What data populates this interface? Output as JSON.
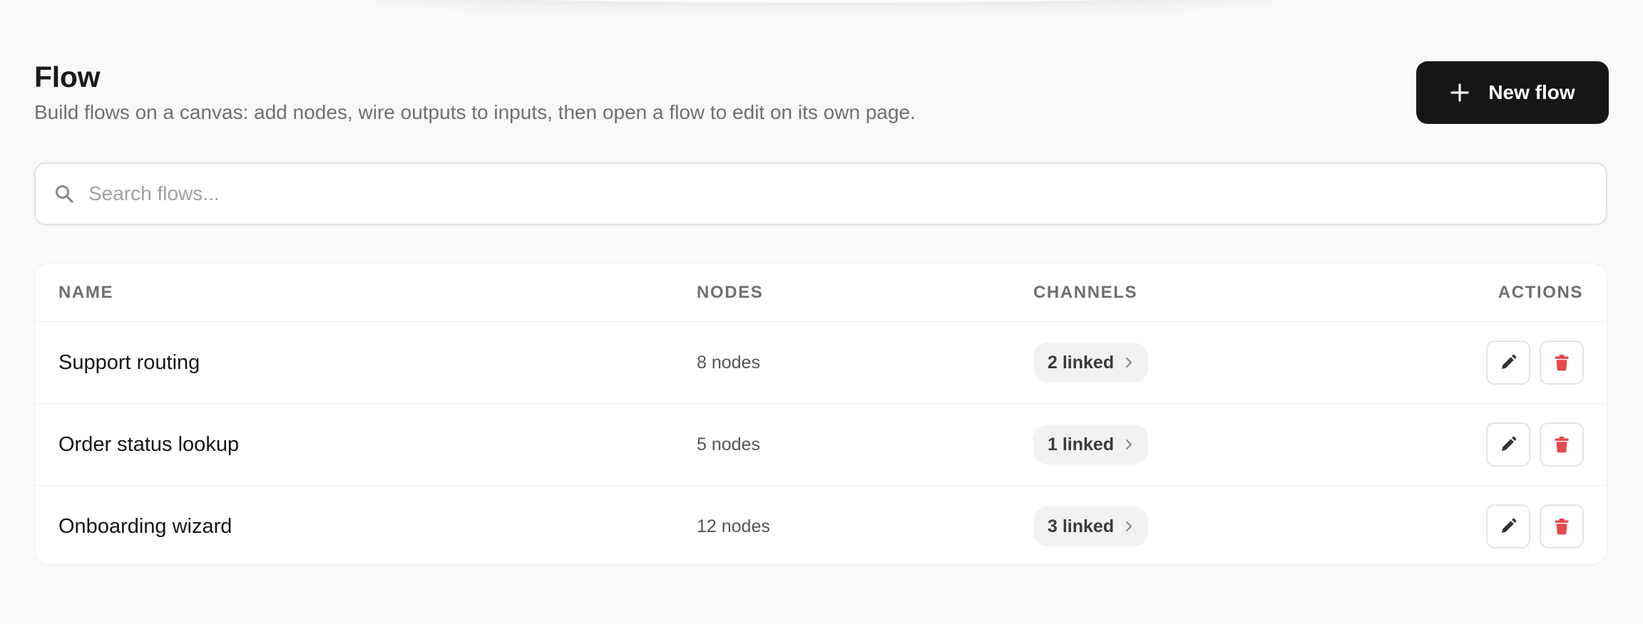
{
  "header": {
    "title": "Flow",
    "subtitle": "Build flows on a canvas: add nodes, wire outputs to inputs, then open a flow to edit on its own page.",
    "new_button_label": "New flow",
    "new_button_icon": "plus-icon"
  },
  "search": {
    "placeholder": "Search flows...",
    "value": "",
    "icon": "search-icon"
  },
  "table": {
    "columns": {
      "name": "NAME",
      "nodes": "NODES",
      "channels": "CHANNELS",
      "actions": "ACTIONS"
    },
    "rows": [
      {
        "name": "Support routing",
        "nodes": "8 nodes",
        "channels": "2 linked"
      },
      {
        "name": "Order status lookup",
        "nodes": "5 nodes",
        "channels": "1 linked"
      },
      {
        "name": "Onboarding wizard",
        "nodes": "12 nodes",
        "channels": "3 linked"
      }
    ],
    "row_actions": [
      "edit-icon",
      "trash-icon"
    ]
  },
  "colors": {
    "primary_button_bg": "#161616",
    "delete_icon": "#e5484d",
    "edit_icon": "#333333",
    "page_bg": "#f9f9f9"
  }
}
